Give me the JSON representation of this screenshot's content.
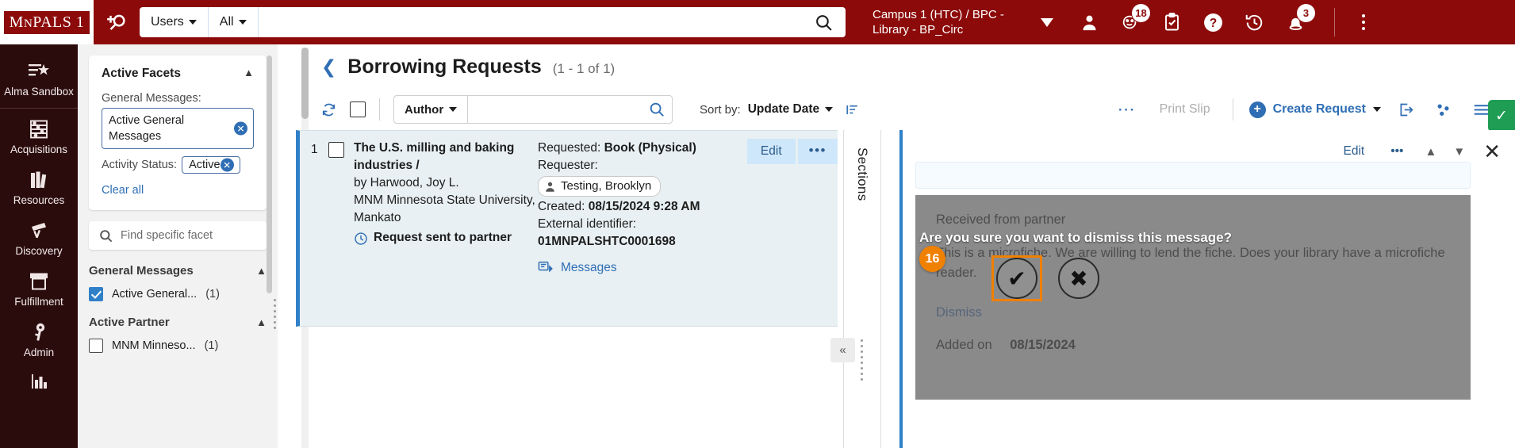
{
  "topbar": {
    "logo_main": "M",
    "logo_rest": "N",
    "logo_text": "PALS 1",
    "logo_full": "MNPALS 1",
    "scope_users": "Users",
    "scope_all": "All",
    "search_value": "",
    "search_placeholder": "",
    "institution": "Campus 1 (HTC) / BPC - Library - BP_Circ",
    "tasks_badge": "18",
    "alerts_badge": "3"
  },
  "leftnav": {
    "items": [
      {
        "label": "Alma Sandbox",
        "icon": "list-star-icon"
      },
      {
        "label": "Acquisitions",
        "icon": "abacus-icon"
      },
      {
        "label": "Resources",
        "icon": "books-icon"
      },
      {
        "label": "Discovery",
        "icon": "telescope-icon"
      },
      {
        "label": "Fulfillment",
        "icon": "archive-box-icon"
      },
      {
        "label": "Admin",
        "icon": "key-icon"
      },
      {
        "label": "",
        "icon": "bar-chart-icon"
      }
    ]
  },
  "facets": {
    "active_title": "Active Facets",
    "general_messages_label": "General Messages:",
    "general_messages_chip": "Active General Messages",
    "activity_status_label": "Activity Status:",
    "activity_status_chip": "Active",
    "clear_all": "Clear all",
    "find_placeholder": "Find specific facet",
    "groups": [
      {
        "title": "General Messages",
        "rows": [
          {
            "label": "Active General...",
            "count": "(1)",
            "checked": true
          }
        ]
      },
      {
        "title": "Active Partner",
        "rows": [
          {
            "label": "MNM Minneso...",
            "count": "(1)",
            "checked": false
          }
        ]
      }
    ]
  },
  "page": {
    "title": "Borrowing Requests",
    "count": "(1 - 1 of 1)"
  },
  "toolbar": {
    "search_field": "Author",
    "search_value": "",
    "sort_label": "Sort by:",
    "sort_value": "Update Date",
    "print_slip": "Print Slip",
    "create_request": "Create Request",
    "more_label": "..."
  },
  "result": {
    "index": "1",
    "title": "The U.S. milling and baking industries /",
    "author": "by Harwood, Joy L.",
    "institution": "MNM Minnesota State University, Mankato",
    "status": "Request sent to partner",
    "requested_label": "Requested:",
    "requested_value": "Book (Physical)",
    "requester_label": "Requester:",
    "requester_value": "Testing, Brooklyn",
    "created_label": "Created:",
    "created_value": "08/15/2024 9:28 AM",
    "external_id_label": "External identifier:",
    "external_id_value": "01MNPALSHTC0001698",
    "messages_link": "Messages",
    "edit_label": "Edit",
    "more_label": "•••"
  },
  "detail": {
    "sections_label": "Sections",
    "edit_label": "Edit",
    "more_label": "•••",
    "message_title": "Received from partner",
    "message_body": "This is a microfiche. We are  willing to lend the fiche. Does your library have a microfiche reader.",
    "dismiss_label": "Dismiss",
    "added_on_label": "Added on",
    "added_on_value": "08/15/2024"
  },
  "confirm": {
    "question": "Are you sure you want to dismiss this message?",
    "yes_glyph": "✔",
    "no_glyph": "✖",
    "step_number": "16"
  },
  "colors": {
    "brand_red": "#8c0a0a",
    "nav_dark": "#2b0c0c",
    "accent_blue": "#2f6eb5",
    "highlight_orange": "#f08000",
    "status_green": "#1f9d55"
  }
}
